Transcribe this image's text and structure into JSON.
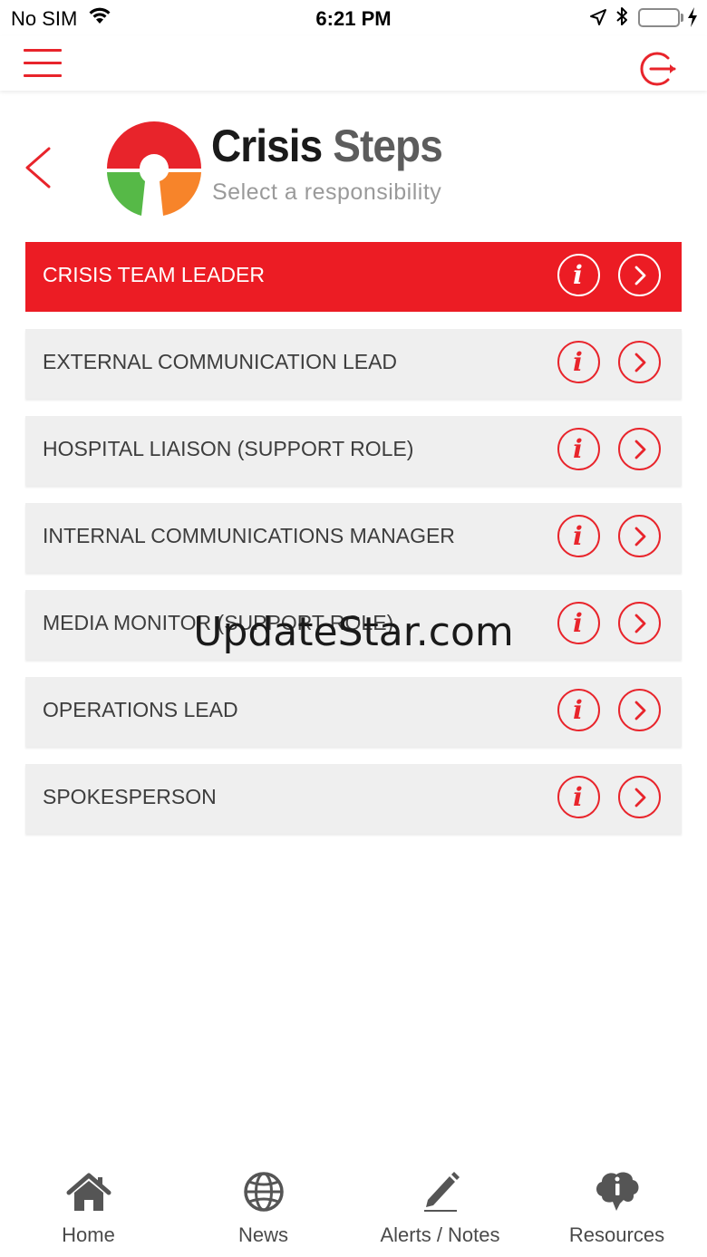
{
  "status_bar": {
    "carrier": "No SIM",
    "time": "6:21 PM",
    "battery_color": "#4cd964"
  },
  "header": {
    "title_part1": "Crisis",
    "title_part2": "Steps",
    "subtitle": "Select a responsibility"
  },
  "colors": {
    "accent": "#e8242b",
    "active_row": "#ec1c24",
    "row_bg": "#efefef"
  },
  "roles": [
    {
      "label": "CRISIS TEAM LEADER",
      "active": true
    },
    {
      "label": "EXTERNAL COMMUNICATION LEAD",
      "active": false
    },
    {
      "label": "HOSPITAL LIAISON (SUPPORT ROLE)",
      "active": false
    },
    {
      "label": "INTERNAL COMMUNICATIONS MANAGER",
      "active": false
    },
    {
      "label": "MEDIA MONITOR (SUPPORT ROLE)",
      "active": false
    },
    {
      "label": "OPERATIONS LEAD",
      "active": false
    },
    {
      "label": "SPOKESPERSON",
      "active": false
    }
  ],
  "watermark": "UpdateStar.com",
  "bottom_nav": {
    "tabs": [
      {
        "label": "Home",
        "icon": "home-icon"
      },
      {
        "label": "News",
        "icon": "globe-icon"
      },
      {
        "label": "Alerts / Notes",
        "icon": "pencil-icon"
      },
      {
        "label": "Resources",
        "icon": "brain-info-icon"
      }
    ]
  }
}
